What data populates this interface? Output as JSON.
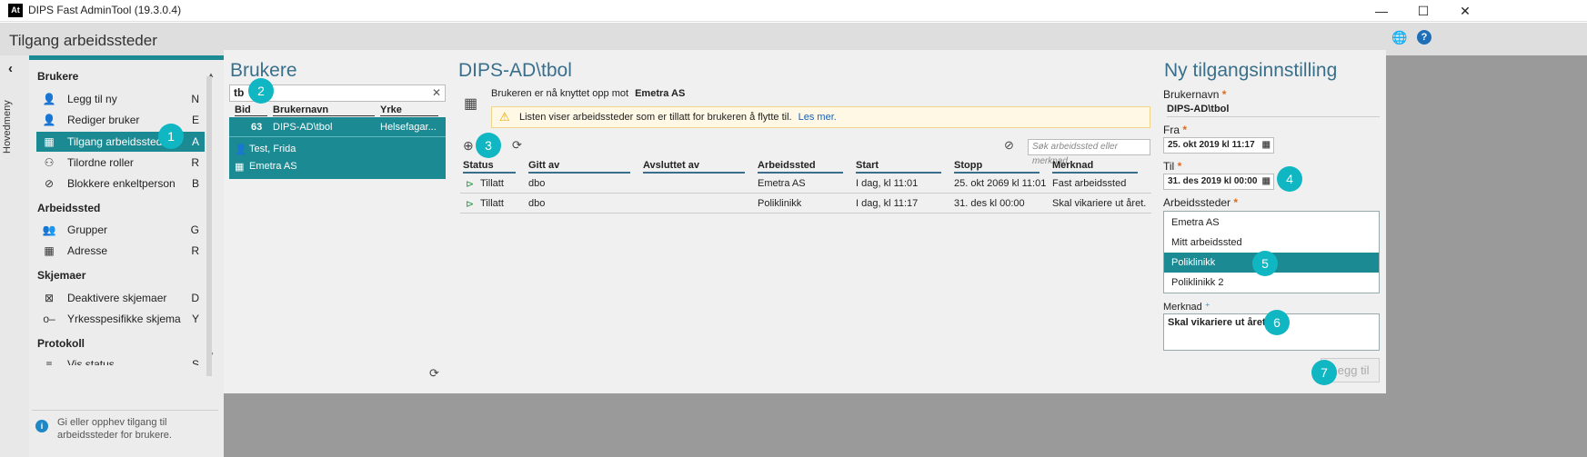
{
  "window": {
    "title": "DIPS Fast AdminTool (19.3.0.4)",
    "logo": "At",
    "minimize": "—",
    "maximize": "☐",
    "close": "✕"
  },
  "header": {
    "title": "Tilgang arbeidssteder",
    "globe_icon": "globe-icon",
    "help_icon": "help-icon"
  },
  "sidebar": {
    "collapse_label": "Hovedmeny",
    "sections": [
      {
        "title": "Brukere",
        "items": [
          {
            "label": "Legg til ny",
            "key": "N",
            "icon": "add-user-icon"
          },
          {
            "label": "Rediger bruker",
            "key": "E",
            "icon": "edit-user-icon"
          },
          {
            "label": "Tilgang arbeidssteder",
            "key": "A",
            "icon": "building-icon",
            "active": true
          },
          {
            "label": "Tilordne roller",
            "key": "R",
            "icon": "role-icon"
          },
          {
            "label": "Blokkere enkeltperson",
            "key": "B",
            "icon": "block-icon"
          }
        ]
      },
      {
        "title": "Arbeidssted",
        "items": [
          {
            "label": "Grupper",
            "key": "G",
            "icon": "group-icon"
          },
          {
            "label": "Adresse",
            "key": "R",
            "icon": "address-icon"
          }
        ]
      },
      {
        "title": "Skjemaer",
        "items": [
          {
            "label": "Deaktivere skjemaer",
            "key": "D",
            "icon": "deactivate-form-icon"
          },
          {
            "label": "Yrkesspesifikke skjema",
            "key": "Y",
            "icon": "key-icon"
          }
        ]
      },
      {
        "title": "Protokoll",
        "items": [
          {
            "label": "Vis status",
            "key": "S",
            "icon": "status-icon"
          }
        ]
      }
    ],
    "hint": "Gi eller opphev tilgang til arbeidssteder for brukere."
  },
  "users_panel": {
    "title": "Brukere",
    "search_value": "tb",
    "columns": [
      "Bid",
      "Brukernavn",
      "Yrke"
    ],
    "row": {
      "bid": "63",
      "username": "DIPS-AD\\tbol",
      "profession": "Helsefagar..."
    },
    "person": "Test, Frida",
    "workplace": "Emetra AS"
  },
  "access_panel": {
    "title": "DIPS-AD\\tbol",
    "info_prefix": "Brukeren er nå knyttet opp mot",
    "info_org": "Emetra AS",
    "notice_text": "Listen viser arbeidssteder som er tillatt for brukeren å flytte til.",
    "notice_link": "Les mer.",
    "search_placeholder": "Søk arbeidssted eller merknad",
    "columns": [
      "Status",
      "Gitt av",
      "Avsluttet av",
      "Arbeidssted",
      "Start",
      "Stopp",
      "Merknad"
    ],
    "rows": [
      {
        "status": "Tillatt",
        "gitt_av": "dbo",
        "avsluttet_av": "",
        "arbeidssted": "Emetra AS",
        "start": "I dag, kl 11:01",
        "stopp": "25. okt 2069 kl 11:01",
        "merknad": "Fast arbeidssted"
      },
      {
        "status": "Tillatt",
        "gitt_av": "dbo",
        "avsluttet_av": "",
        "arbeidssted": "Poliklinikk",
        "start": "I dag, kl 11:17",
        "stopp": "31. des kl 00:00",
        "merknad": "Skal vikariere ut året."
      }
    ]
  },
  "new_access": {
    "title": "Ny tilgangsinnstilling",
    "username_label": "Brukernavn",
    "username_value": "DIPS-AD\\tbol",
    "from_label": "Fra",
    "from_value": "25. okt 2019 kl 11:17",
    "to_label": "Til",
    "to_value": "31. des 2019 kl 00:00",
    "workplaces_label": "Arbeidssteder",
    "workplaces": [
      "Emetra AS",
      "Mitt arbeidssted",
      "Poliklinikk",
      "Poliklinikk 2"
    ],
    "selected_workplace": "Poliklinikk",
    "note_label": "Merknad",
    "note_value": "Skal vikariere ut året.",
    "add_button": "Legg til"
  },
  "badges": [
    "1",
    "2",
    "3",
    "4",
    "5",
    "6",
    "7"
  ],
  "colors": {
    "accent": "#1b8a93",
    "badge": "#10b6c2",
    "title_blue": "#3a6f8c",
    "required": "#e06a1a"
  }
}
